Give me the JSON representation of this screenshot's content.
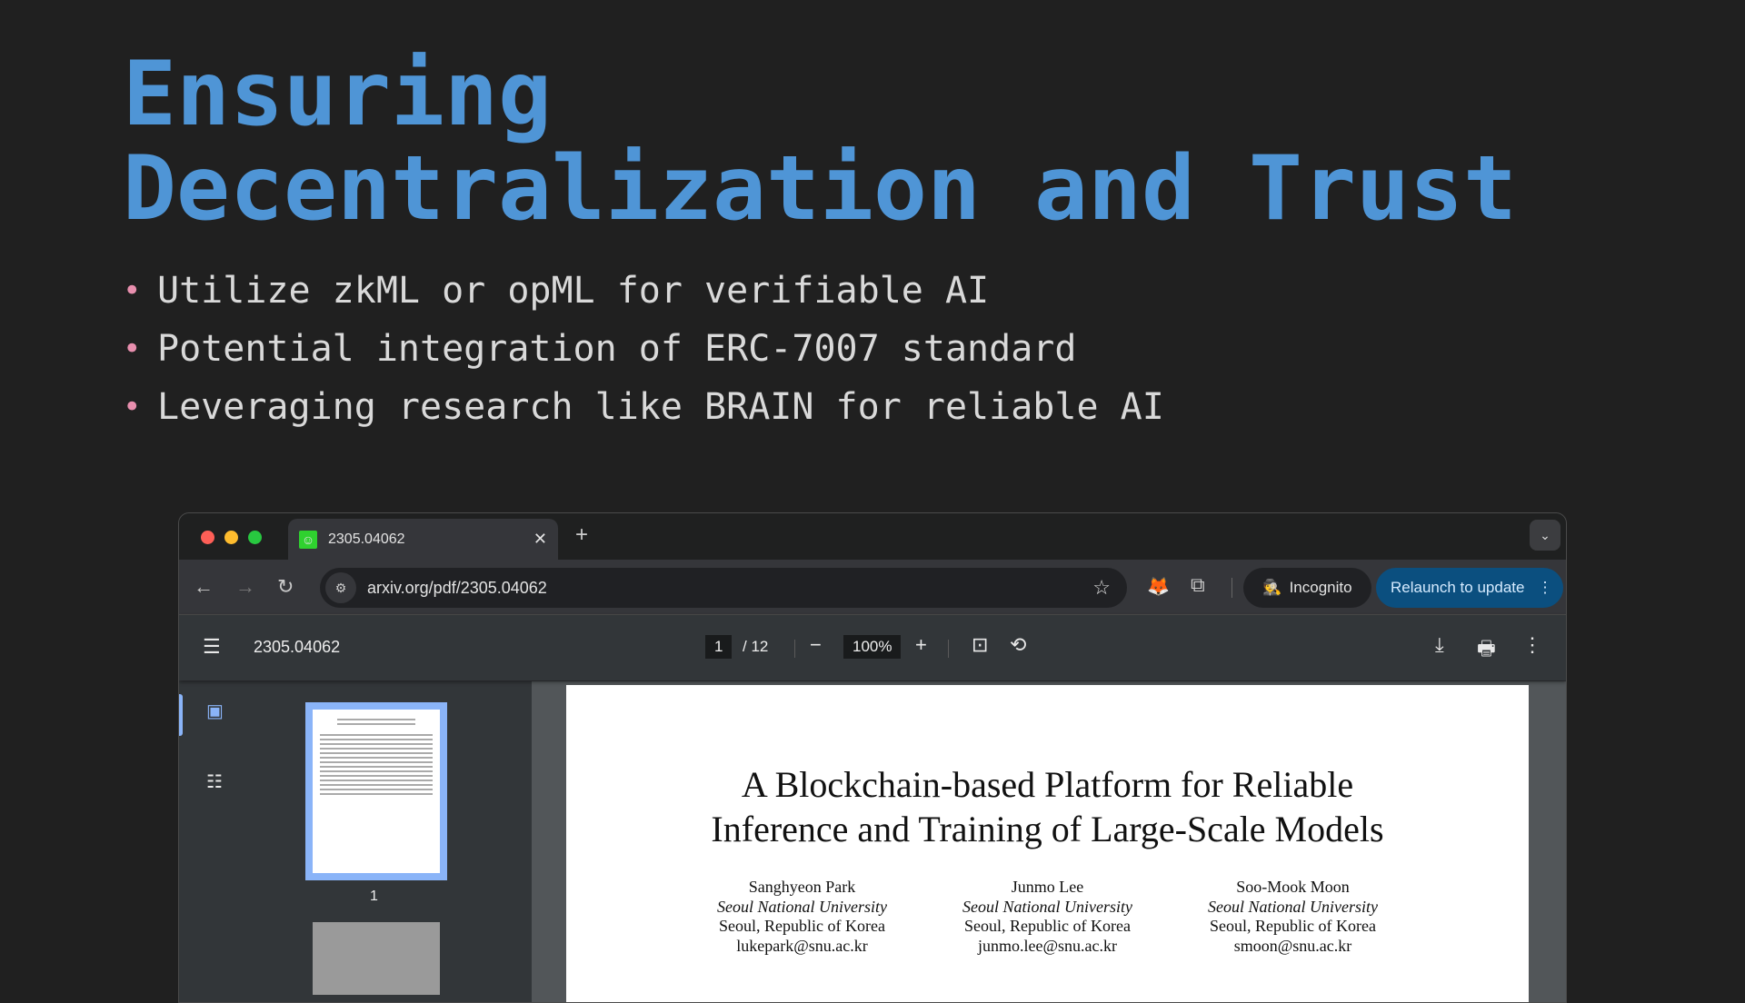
{
  "slide": {
    "title_line1": "Ensuring",
    "title_line2": "Decentralization and Trust",
    "bullets": [
      "Utilize zkML or opML for verifiable AI",
      "Potential integration of ERC-7007 standard",
      "Leveraging research like BRAIN for reliable AI"
    ]
  },
  "browser": {
    "tab_title": "2305.04062",
    "url": "arxiv.org/pdf/2305.04062",
    "incognito_label": "Incognito",
    "relaunch_label": "Relaunch to update"
  },
  "pdf": {
    "doc_title": "2305.04062",
    "current_page": "1",
    "total_pages": "/ 12",
    "zoom": "100%",
    "thumb_label": "1",
    "paper_title_line1": "A Blockchain-based Platform for Reliable",
    "paper_title_line2": "Inference and Training of Large-Scale Models",
    "authors": [
      {
        "name": "Sanghyeon Park",
        "affiliation": "Seoul National University",
        "location": "Seoul, Republic of Korea",
        "email": "lukepark@snu.ac.kr"
      },
      {
        "name": "Junmo Lee",
        "affiliation": "Seoul National University",
        "location": "Seoul, Republic of Korea",
        "email": "junmo.lee@snu.ac.kr"
      },
      {
        "name": "Soo-Mook Moon",
        "affiliation": "Seoul National University",
        "location": "Seoul, Republic of Korea",
        "email": "smoon@snu.ac.kr"
      }
    ]
  },
  "colors": {
    "title": "#4f95d6",
    "bullet": "#e88fae",
    "relaunch": "#0b4f7f"
  }
}
